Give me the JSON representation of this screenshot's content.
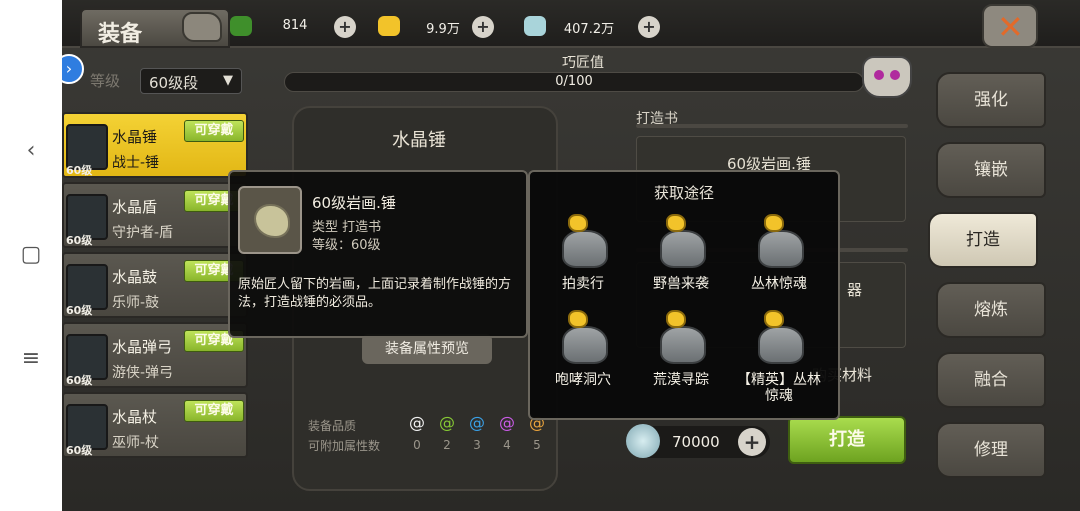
{
  "screen": {
    "title": "装备",
    "resources": [
      {
        "name": "stamina",
        "icon": "stamina-icon",
        "value": "814"
      },
      {
        "name": "gold",
        "icon": "gold-icon",
        "value": "9.9万"
      },
      {
        "name": "shell",
        "icon": "shell-icon",
        "value": "407.2万"
      }
    ]
  },
  "filter": {
    "label": "等级",
    "selected": "60级段"
  },
  "items": [
    {
      "name": "水晶锤",
      "sub": "战士-锤",
      "level": "60级",
      "tag": "可穿戴",
      "selected": true
    },
    {
      "name": "水晶盾",
      "sub": "守护者-盾",
      "level": "60级",
      "tag": "可穿戴",
      "selected": false
    },
    {
      "name": "水晶鼓",
      "sub": "乐师-鼓",
      "level": "60级",
      "tag": "可穿戴",
      "selected": false
    },
    {
      "name": "水晶弹弓",
      "sub": "游侠-弹弓",
      "level": "60级",
      "tag": "可穿戴",
      "selected": false
    },
    {
      "name": "水晶杖",
      "sub": "巫师-杖",
      "level": "60级",
      "tag": "可穿戴",
      "selected": false
    }
  ],
  "craft": {
    "skill_label": "巧匠值",
    "skill_value": "0/100",
    "skill_fraction": 0,
    "item_title": "水晶锤",
    "preview_button": "装备属性预览",
    "book_label": "打造书",
    "book_name": "60级岩画.锤",
    "material_name": "器",
    "buy_material": "购买材料",
    "cost": "70000",
    "forge_button": "打造",
    "quality_label": "装备品质",
    "extra_attr_label": "可附加属性数",
    "quality_numbers": [
      "0",
      "2",
      "3",
      "4",
      "5"
    ],
    "quality_colors": [
      "#f0f0f0",
      "#86c934",
      "#3aa0e6",
      "#c95be6",
      "#e8a23c"
    ]
  },
  "tabs": [
    {
      "label": "强化",
      "active": false
    },
    {
      "label": "镶嵌",
      "active": false
    },
    {
      "label": "打造",
      "active": true
    },
    {
      "label": "熔炼",
      "active": false
    },
    {
      "label": "融合",
      "active": false
    },
    {
      "label": "修理",
      "active": false
    }
  ],
  "tooltip": {
    "title": "60级岩画.锤",
    "type": "类型   打造书",
    "level": "等级：60级",
    "description": "原始匠人留下的岩画，上面记录着制作战锤的方法，打造战锤的必须品。"
  },
  "acquire": {
    "title": "获取途径",
    "sources": [
      "拍卖行",
      "野兽来袭",
      "丛林惊魂",
      "咆哮洞穴",
      "荒漠寻踪",
      "【精英】丛林惊魂"
    ]
  }
}
